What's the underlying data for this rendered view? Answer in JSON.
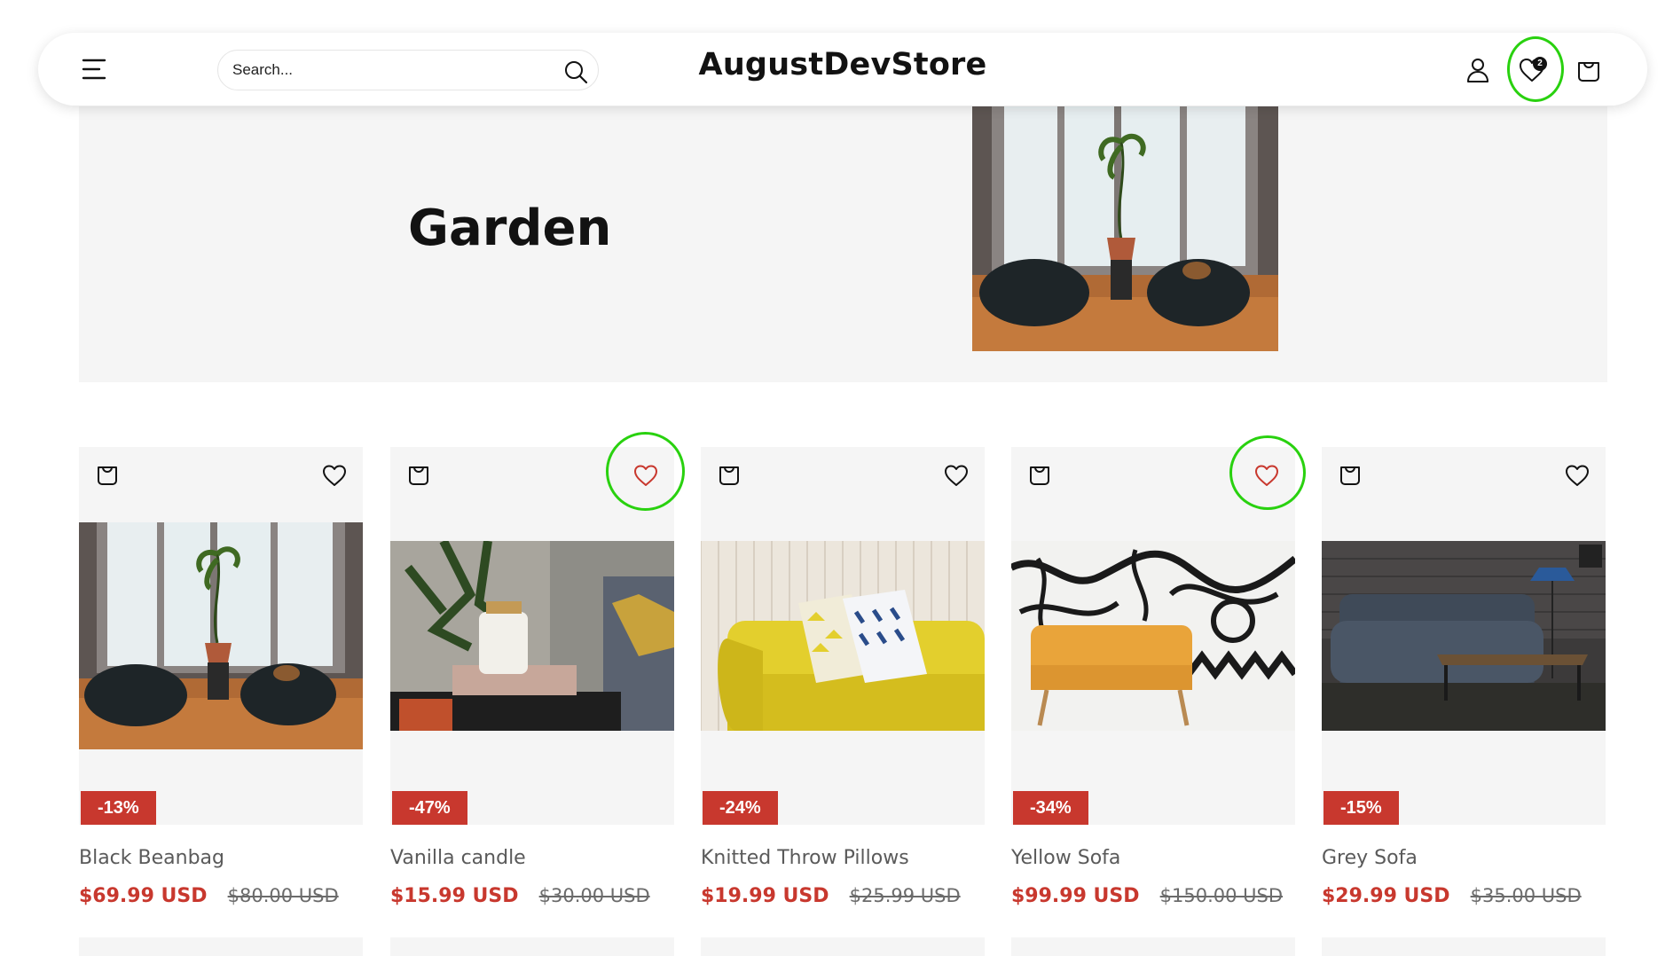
{
  "header": {
    "brand": "AugustDevStore",
    "search_placeholder": "Search...",
    "wishlist_count": "2"
  },
  "banner": {
    "title": "Garden"
  },
  "colors": {
    "accent_sale": "#c8382e",
    "highlight_ring": "#29d10f",
    "card_bg": "#f5f5f5"
  },
  "products": [
    {
      "title": "Black Beanbag",
      "badge": "-13%",
      "price": "$69.99 USD",
      "compare_price": "$80.00 USD",
      "wishlisted": false,
      "image": "beanbag-room-photo"
    },
    {
      "title": "Vanilla candle",
      "badge": "-47%",
      "price": "$15.99 USD",
      "compare_price": "$30.00 USD",
      "wishlisted": true,
      "image": "candle-on-books-photo"
    },
    {
      "title": "Knitted Throw Pillows",
      "badge": "-24%",
      "price": "$19.99 USD",
      "compare_price": "$25.99 USD",
      "wishlisted": false,
      "image": "yellow-sofa-pillows-photo"
    },
    {
      "title": "Yellow Sofa",
      "badge": "-34%",
      "price": "$99.99 USD",
      "compare_price": "$150.00 USD",
      "wishlisted": true,
      "image": "yellow-sofa-mural-photo"
    },
    {
      "title": "Grey Sofa",
      "badge": "-15%",
      "price": "$29.99 USD",
      "compare_price": "$35.00 USD",
      "wishlisted": false,
      "image": "grey-sofa-brick-photo"
    }
  ]
}
